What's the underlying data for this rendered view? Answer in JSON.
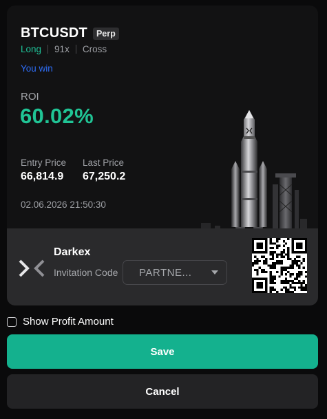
{
  "position": {
    "pair": "BTCUSDT",
    "badge": "Perp",
    "side": "Long",
    "leverage": "91x",
    "margin_mode": "Cross",
    "result": "You win",
    "roi_label": "ROI",
    "roi_value": "60.02%",
    "entry_label": "Entry Price",
    "entry_value": "66,814.9",
    "last_label": "Last Price",
    "last_value": "67,250.2",
    "timestamp": "02.06.2026 21:50:30"
  },
  "footer": {
    "brand": "Darkex",
    "invite_label": "Invitation Code",
    "invite_value": "PARTNE..."
  },
  "controls": {
    "show_profit_label": "Show Profit Amount",
    "show_profit_checked": false,
    "save_label": "Save",
    "cancel_label": "Cancel"
  },
  "colors": {
    "accent": "#14b18e",
    "profit": "#20c495",
    "long": "#1fc49a",
    "win": "#2e6df6",
    "background": "#0a0a0b",
    "card": "#121213",
    "footer": "#2a2a2c"
  },
  "icons": {
    "brand_logo": "darkex-logo-icon",
    "dropdown": "chevron-down-icon",
    "checkbox": "checkbox-icon",
    "qr": "qr-code",
    "illustration": "rocket-illustration"
  }
}
